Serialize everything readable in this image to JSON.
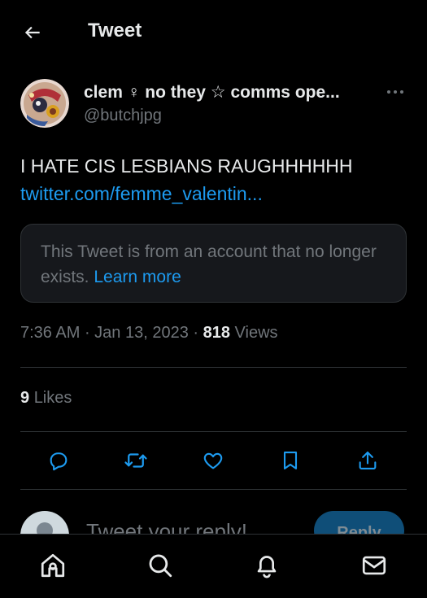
{
  "header": {
    "title": "Tweet"
  },
  "tweet": {
    "display_name": "clem ♀ no they ☆ comms ope...",
    "handle": "@butchjpg",
    "text": "I HATE CIS LESBIANS RAUGHHHHHH",
    "link": "twitter.com/femme_valentin...",
    "notice": {
      "text": "This Tweet is from an account that no longer exists.",
      "learn_more": "Learn more"
    },
    "time": "7:36 AM",
    "date": "Jan 13, 2023",
    "views_count": "818",
    "views_label": "Views",
    "likes_count": "9",
    "likes_label": "Likes"
  },
  "actions": [
    "reply-icon",
    "retweet-icon",
    "like-icon",
    "bookmark-icon",
    "share-icon"
  ],
  "reply_composer": {
    "placeholder": "Tweet your reply!",
    "button_label": "Reply"
  },
  "tabbar": [
    "home-icon",
    "search-icon",
    "notifications-icon",
    "messages-icon"
  ],
  "colors": {
    "accent": "#1d9bf0",
    "text": "#e7e9ea",
    "muted": "#71767b",
    "border": "#2f3336",
    "background": "#000000"
  }
}
